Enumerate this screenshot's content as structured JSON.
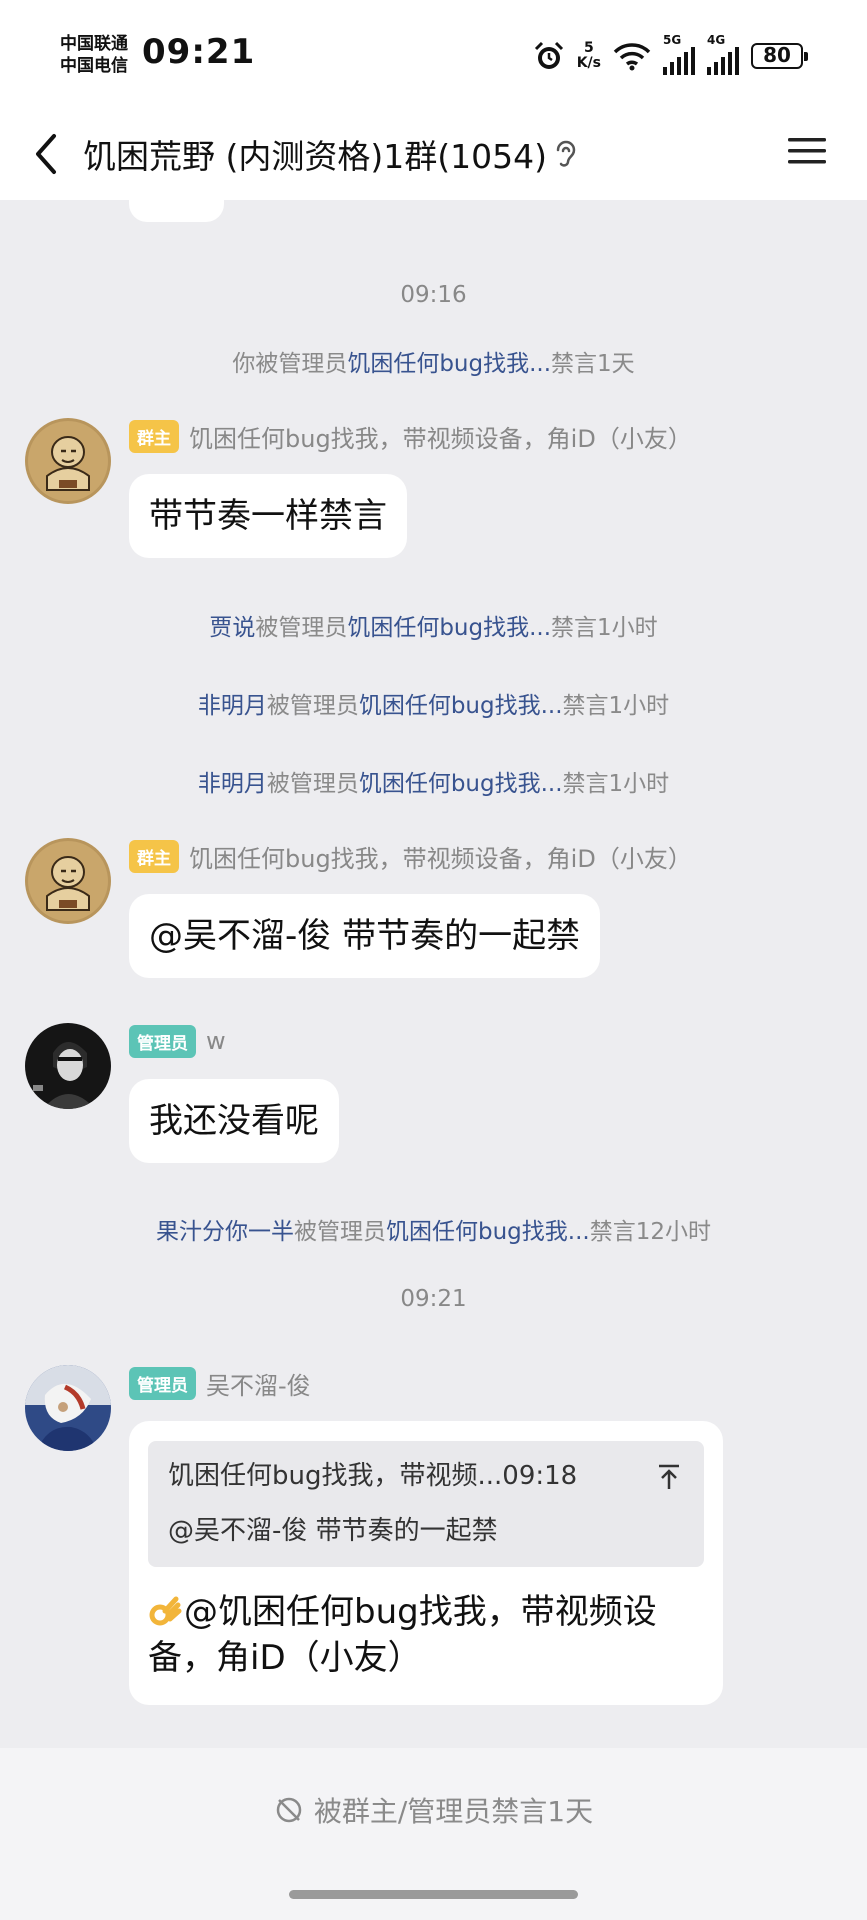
{
  "status_bar": {
    "carrier1": "中国联通",
    "carrier2": "中国电信",
    "time": "09:21",
    "speed_value": "5",
    "speed_unit": "K/s",
    "net1": "5G",
    "net2": "4G",
    "battery": "80"
  },
  "header": {
    "title": "饥困荒野 (内测资格)1群(1054)",
    "back_icon": "chevron-left-icon",
    "ear_icon": "ear-icon",
    "menu_icon": "hamburger-menu-icon"
  },
  "chat": {
    "time1": "09:16",
    "sys1": {
      "prefix": "你被管理员",
      "admin": "饥困任何bug找我...",
      "suffix": "禁言1天"
    },
    "msg1": {
      "badge": "群主",
      "nick": "饥困任何bug找我，带视频设备，角iD（小友）",
      "text": "带节奏一样禁言"
    },
    "sys2": {
      "user": "贾说",
      "mid": "被管理员",
      "admin": "饥困任何bug找我...",
      "suffix": "禁言1小时"
    },
    "sys3": {
      "user": "非明月",
      "mid": "被管理员",
      "admin": "饥困任何bug找我...",
      "suffix": "禁言1小时"
    },
    "sys4": {
      "user": "非明月",
      "mid": "被管理员",
      "admin": "饥困任何bug找我...",
      "suffix": "禁言1小时"
    },
    "msg2": {
      "badge": "群主",
      "nick": "饥困任何bug找我，带视频设备，角iD（小友）",
      "text": "@吴不溜-俊 带节奏的一起禁"
    },
    "msg3": {
      "badge": "管理员",
      "nick": "w",
      "text": "我还没看呢"
    },
    "sys5": {
      "user": "果汁分你一半",
      "mid": "被管理员",
      "admin": "饥困任何bug找我...",
      "suffix": "禁言12小时"
    },
    "time2": "09:21",
    "msg4": {
      "badge": "管理员",
      "nick": "吴不溜-俊",
      "quote_head": "饥困任何bug找我，带视频...09:18",
      "quote_body": "@吴不溜-俊 带节奏的一起禁",
      "text": "@饥困任何bug找我，带视频设备，角iD（小友）"
    }
  },
  "footer": {
    "mute_text": "被群主/管理员禁言1天"
  }
}
